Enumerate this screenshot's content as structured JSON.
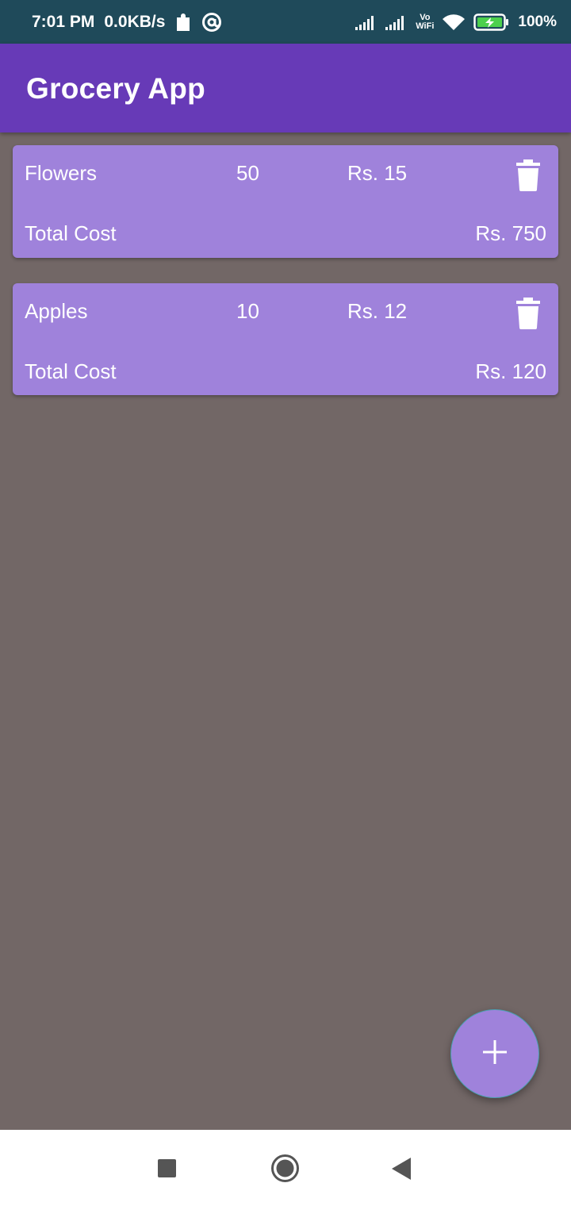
{
  "status_bar": {
    "time": "7:01 PM",
    "net_speed": "0.0KB/s",
    "battery": "100%",
    "vo_label_top": "Vo",
    "vo_label_bottom": "WiFi",
    "icons": [
      "puzzle-icon",
      "at-sign-icon",
      "signal-icon",
      "signal-icon",
      "vowifi-icon",
      "wifi-icon",
      "battery-charging-icon"
    ]
  },
  "app_bar": {
    "title": "Grocery App",
    "color": "#673ab7"
  },
  "items": [
    {
      "name": "Flowers",
      "quantity": "50",
      "price": "Rs. 15",
      "total_label": "Total Cost",
      "total": "Rs. 750",
      "delete_icon": "trash-icon"
    },
    {
      "name": "Apples",
      "quantity": "10",
      "price": "Rs. 12",
      "total_label": "Total Cost",
      "total": "Rs. 120",
      "delete_icon": "trash-icon"
    }
  ],
  "fab": {
    "icon": "plus-icon",
    "color": "#9f82db"
  },
  "nav_bar": {
    "icons": [
      "recents-square-icon",
      "home-circle-icon",
      "back-triangle-icon"
    ]
  },
  "colors": {
    "background": "#726766",
    "card": "#9f82db",
    "status_bar": "#1f4a5a"
  }
}
